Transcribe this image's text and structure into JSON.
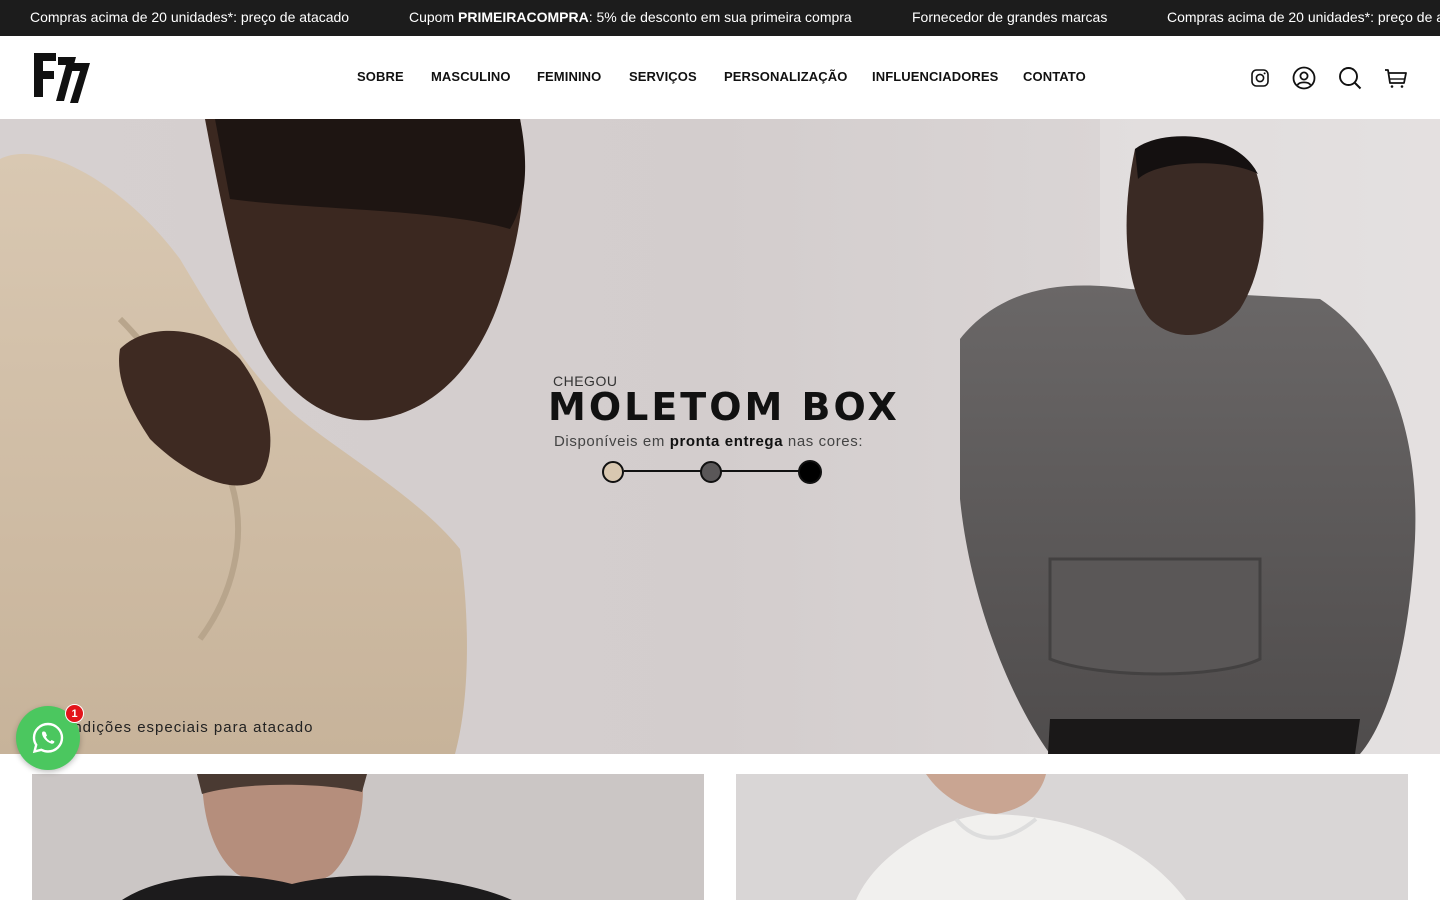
{
  "announcement": {
    "items": [
      {
        "pre": "Compras acima de 20 unidades*: preço de atacado",
        "bold": "",
        "post": ""
      },
      {
        "pre": "Cupom ",
        "bold": "PRIMEIRACOMPRA",
        "post": ": 5% de desconto em sua primeira compra"
      },
      {
        "pre": "Fornecedor de grandes marcas",
        "bold": "",
        "post": ""
      },
      {
        "pre": "Compras acima de 20 unidades*: preço de a",
        "bold": "",
        "post": ""
      }
    ]
  },
  "header": {
    "logo_text": "F77",
    "nav": [
      "SOBRE",
      "MASCULINO",
      "FEMININO",
      "SERVIÇOS",
      "PERSONALIZAÇÃO",
      "INFLUENCIADORES",
      "CONTATO"
    ],
    "icons": [
      "instagram-icon",
      "account-icon",
      "search-icon",
      "cart-icon"
    ]
  },
  "hero": {
    "kicker": "CHEGOU",
    "title": "MOLETOM BOX",
    "subtitle_pre": "Disponíveis em ",
    "subtitle_bold": "pronta entrega",
    "subtitle_post": " nas cores:",
    "footnote": "ondições especiais para atacado",
    "color_swatches": [
      "#d8c7b0",
      "#5a5758",
      "#000000"
    ]
  },
  "whatsapp": {
    "badge_count": "1",
    "accent": "#4bc75f"
  },
  "colors": {
    "announce_bg": "#1c1c1c",
    "hero_bg": "#d4cecf"
  }
}
